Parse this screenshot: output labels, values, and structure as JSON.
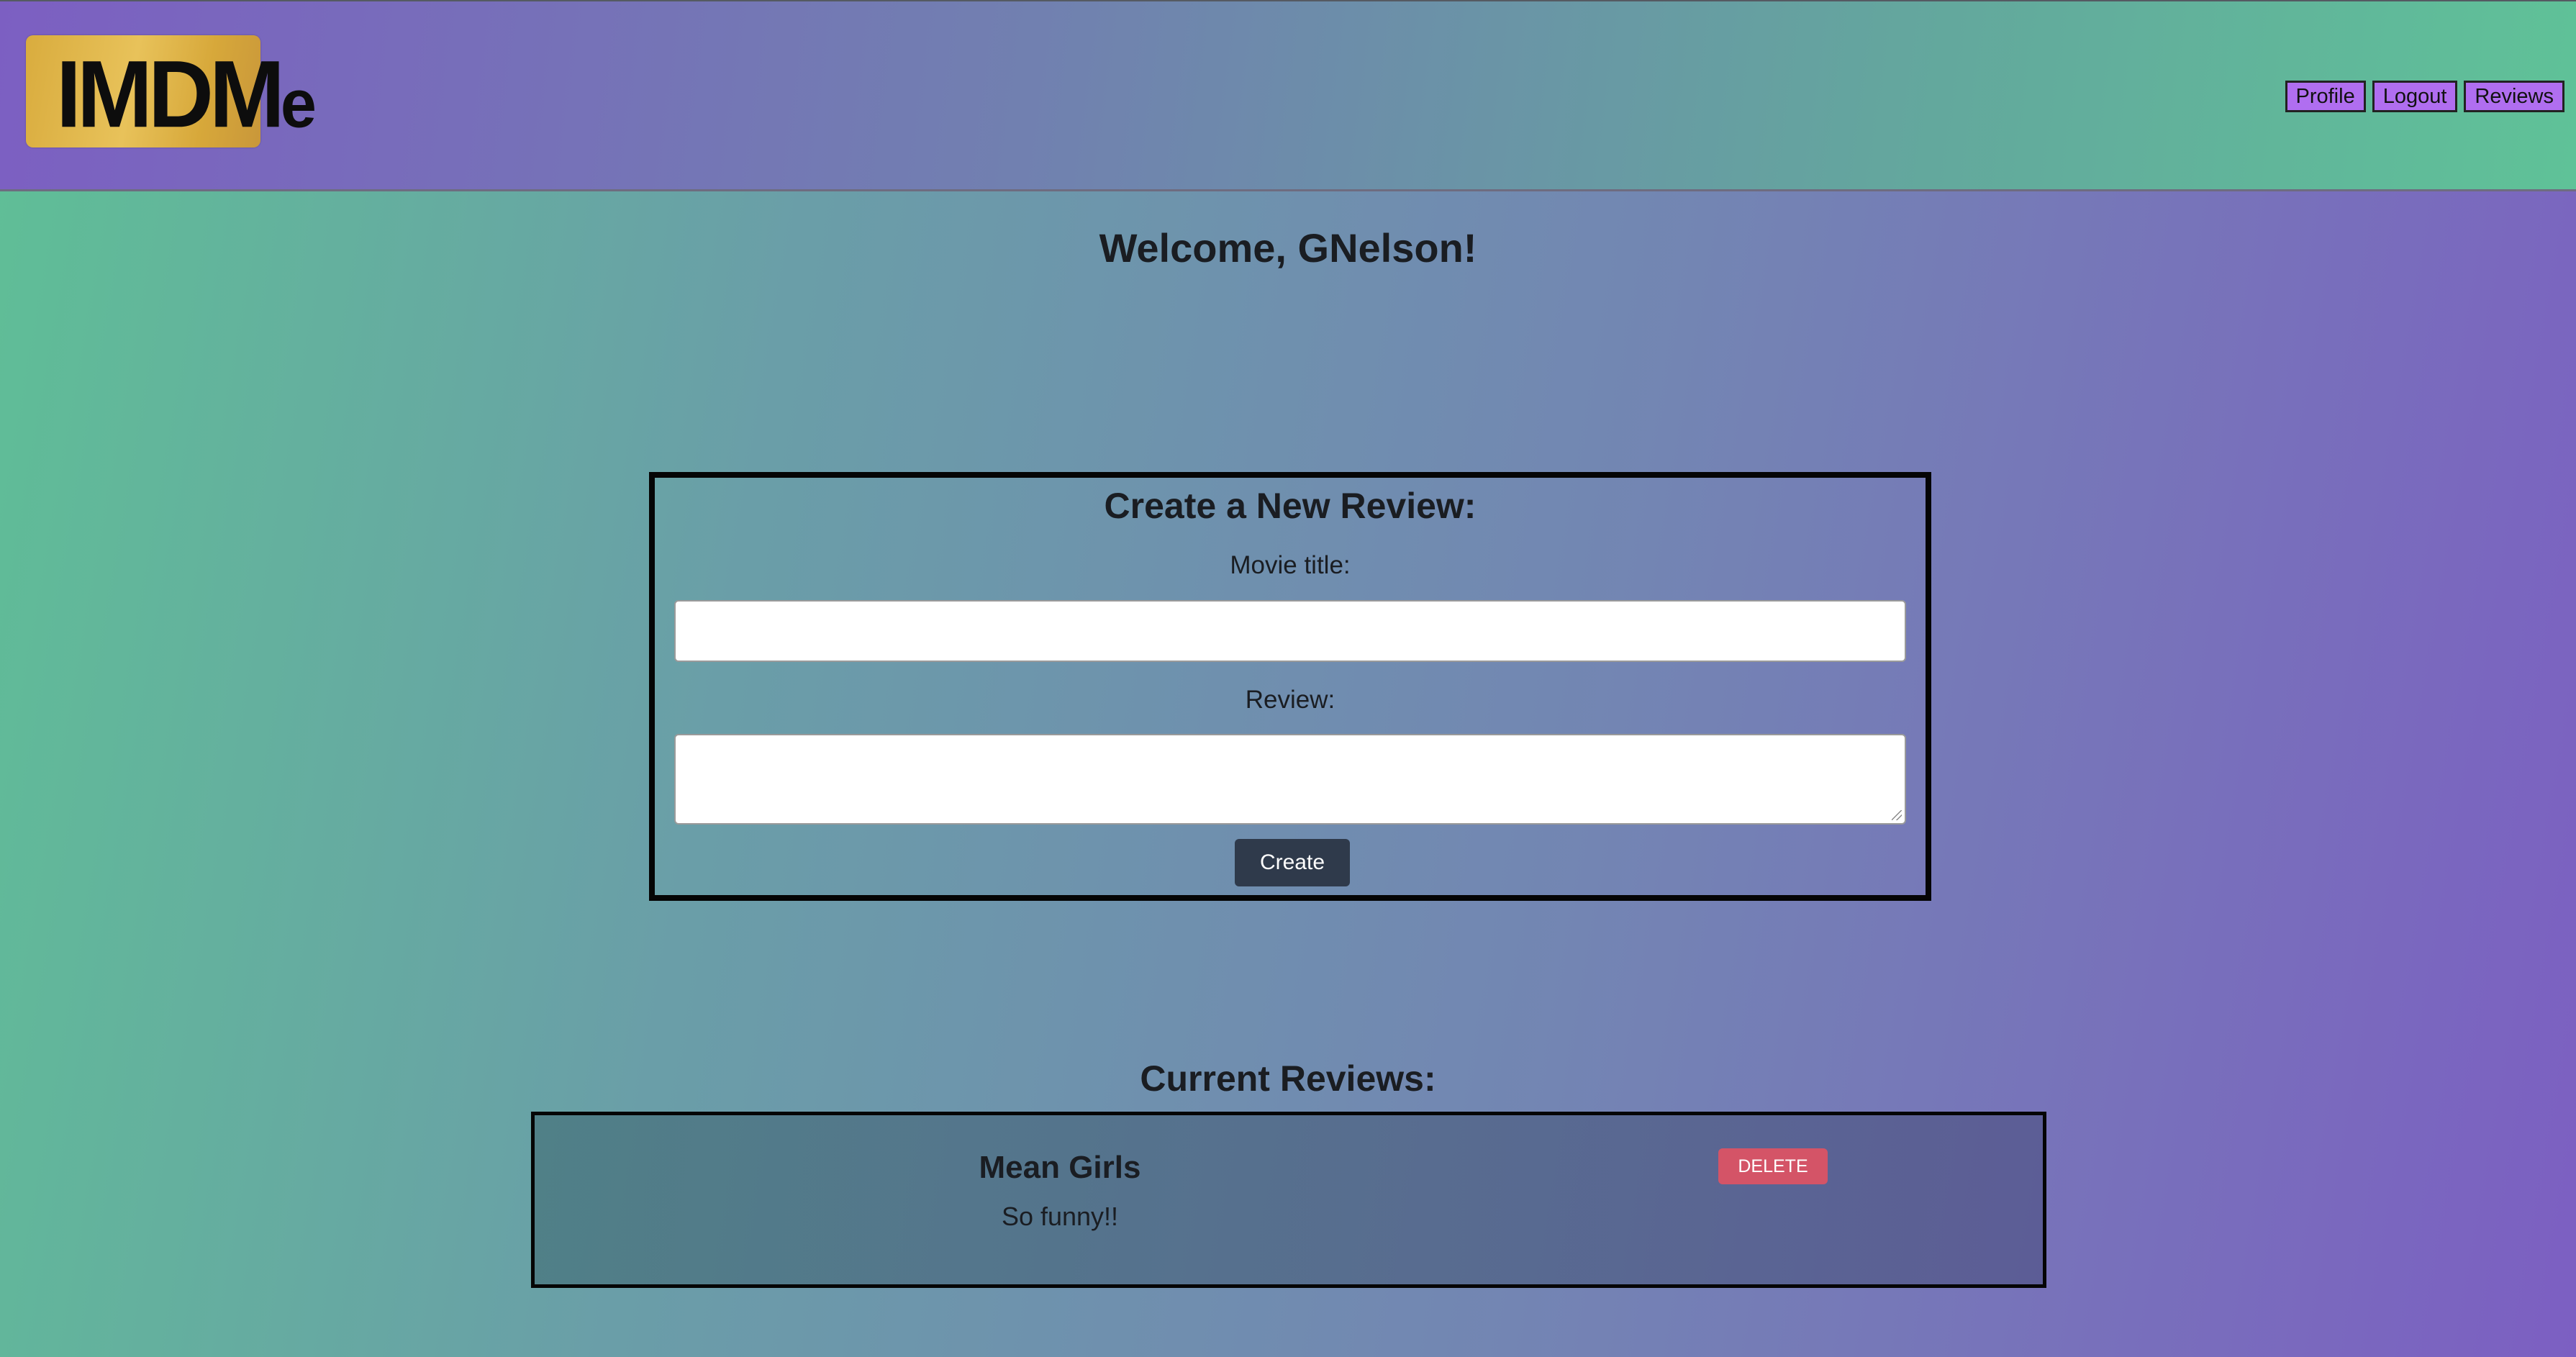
{
  "header": {
    "logo": {
      "text_main": "IMDM",
      "text_suffix": "e"
    },
    "nav": {
      "profile_label": "Profile",
      "logout_label": "Logout",
      "reviews_label": "Reviews"
    }
  },
  "main": {
    "welcome": "Welcome, GNelson!",
    "form": {
      "title": "Create a New Review:",
      "movie_title_label": "Movie title:",
      "movie_title_value": "",
      "review_label": "Review:",
      "review_value": "",
      "create_label": "Create"
    },
    "reviews_section": {
      "title": "Current Reviews:",
      "items": [
        {
          "title": "Mean Girls",
          "body": "So funny!!",
          "delete_label": "DELETE"
        }
      ]
    }
  },
  "colors": {
    "nav_button": "#b06ef0",
    "create_button": "#2f3a4b",
    "delete_button": "#d45467",
    "logo_gold": "#e0b84c"
  }
}
